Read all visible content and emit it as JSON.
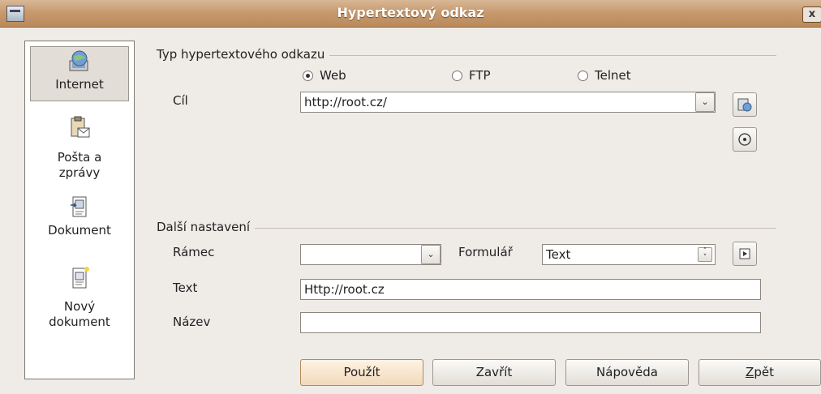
{
  "window": {
    "title": "Hypertextový odkaz",
    "close_label": "x"
  },
  "sidebar": {
    "items": [
      {
        "label": "Internet",
        "icon": "globe-computer-icon",
        "selected": true
      },
      {
        "label": "Pošta a zprávy",
        "line1": "Pošta a",
        "line2": "zprávy",
        "icon": "mail-clipboard-icon"
      },
      {
        "label": "Dokument",
        "icon": "document-icon"
      },
      {
        "label": "Nový dokument",
        "line1": "Nový",
        "line2": "dokument",
        "icon": "new-document-icon"
      }
    ]
  },
  "type_group": {
    "label": "Typ hypertextového odkazu",
    "options": [
      {
        "label": "Web",
        "checked": true
      },
      {
        "label": "FTP",
        "checked": false
      },
      {
        "label": "Telnet",
        "checked": false
      }
    ]
  },
  "target": {
    "label": "Cíl",
    "value": "http://root.cz/"
  },
  "more": {
    "label": "Další nastavení",
    "frame_label": "Rámec",
    "frame_value": "",
    "form_label": "Formulář",
    "form_value": "Text",
    "text_label": "Text",
    "text_value": "Http://root.cz",
    "name_label": "Název",
    "name_value": ""
  },
  "buttons": {
    "apply": "Použít",
    "close": "Zavřít",
    "help": "Nápověda",
    "back_mnemonic": "Z",
    "back_rest": "pět"
  }
}
